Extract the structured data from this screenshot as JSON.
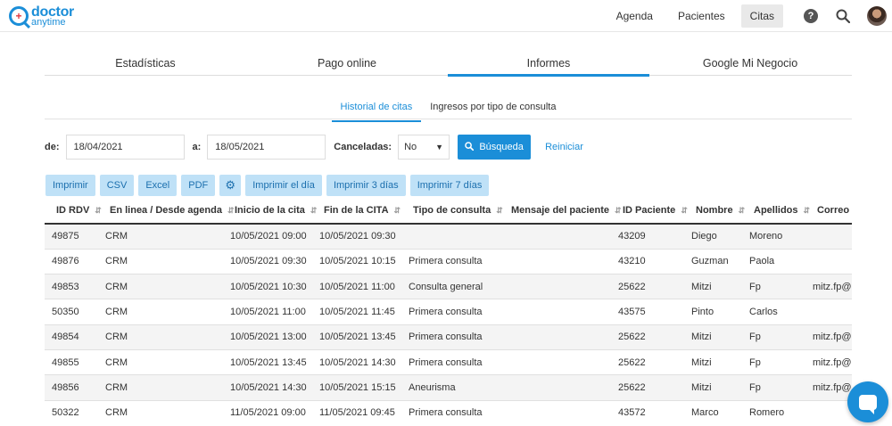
{
  "brand": {
    "top": "doctor",
    "bottom": "anytime"
  },
  "nav": {
    "agenda": "Agenda",
    "pacientes": "Pacientes",
    "citas": "Citas"
  },
  "main_tabs": [
    "Estadísticas",
    "Pago online",
    "Informes",
    "Google Mi Negocio"
  ],
  "sub_tabs": [
    "Historial de citas",
    "Ingresos por tipo de consulta"
  ],
  "filters": {
    "from_label": "de:",
    "from_value": "18/04/2021",
    "to_label": "a:",
    "to_value": "18/05/2021",
    "cancel_label": "Canceladas:",
    "cancel_value": "No",
    "search_label": "Búsqueda",
    "reset_label": "Reiniciar"
  },
  "exports": [
    "Imprimir",
    "CSV",
    "Excel",
    "PDF",
    "Imprimir el día",
    "Imprimir 3 días",
    "Imprimir 7 días"
  ],
  "table": {
    "headers": [
      "ID RDV",
      "En linea / Desde agenda",
      "Inicio de la cita",
      "Fin de la CITA",
      "Tipo de consulta",
      "Mensaje del paciente",
      "ID Paciente",
      "Nombre",
      "Apellidos",
      "Correo el"
    ],
    "rows": [
      [
        "49875",
        "CRM",
        "10/05/2021 09:00",
        "10/05/2021 09:30",
        "",
        "",
        "43209",
        "Diego",
        "Moreno",
        ""
      ],
      [
        "49876",
        "CRM",
        "10/05/2021 09:30",
        "10/05/2021 10:15",
        "Primera consulta",
        "",
        "43210",
        "Guzman",
        "Paola",
        ""
      ],
      [
        "49853",
        "CRM",
        "10/05/2021 10:30",
        "10/05/2021 11:00",
        "Consulta general",
        "",
        "25622",
        "Mitzi",
        "Fp",
        "mitz.fp@g"
      ],
      [
        "50350",
        "CRM",
        "10/05/2021 11:00",
        "10/05/2021 11:45",
        "Primera consulta",
        "",
        "43575",
        "Pinto",
        "Carlos",
        ""
      ],
      [
        "49854",
        "CRM",
        "10/05/2021 13:00",
        "10/05/2021 13:45",
        "Primera consulta",
        "",
        "25622",
        "Mitzi",
        "Fp",
        "mitz.fp@g"
      ],
      [
        "49855",
        "CRM",
        "10/05/2021 13:45",
        "10/05/2021 14:30",
        "Primera consulta",
        "",
        "25622",
        "Mitzi",
        "Fp",
        "mitz.fp@g"
      ],
      [
        "49856",
        "CRM",
        "10/05/2021 14:30",
        "10/05/2021 15:15",
        "Aneurisma",
        "",
        "25622",
        "Mitzi",
        "Fp",
        "mitz.fp@g"
      ],
      [
        "50322",
        "CRM",
        "11/05/2021 09:00",
        "11/05/2021 09:45",
        "Primera consulta",
        "",
        "43572",
        "Marco",
        "Romero",
        ""
      ]
    ]
  },
  "colors": {
    "accent": "#1b8ed8",
    "export_bg": "#bfe1f7"
  }
}
